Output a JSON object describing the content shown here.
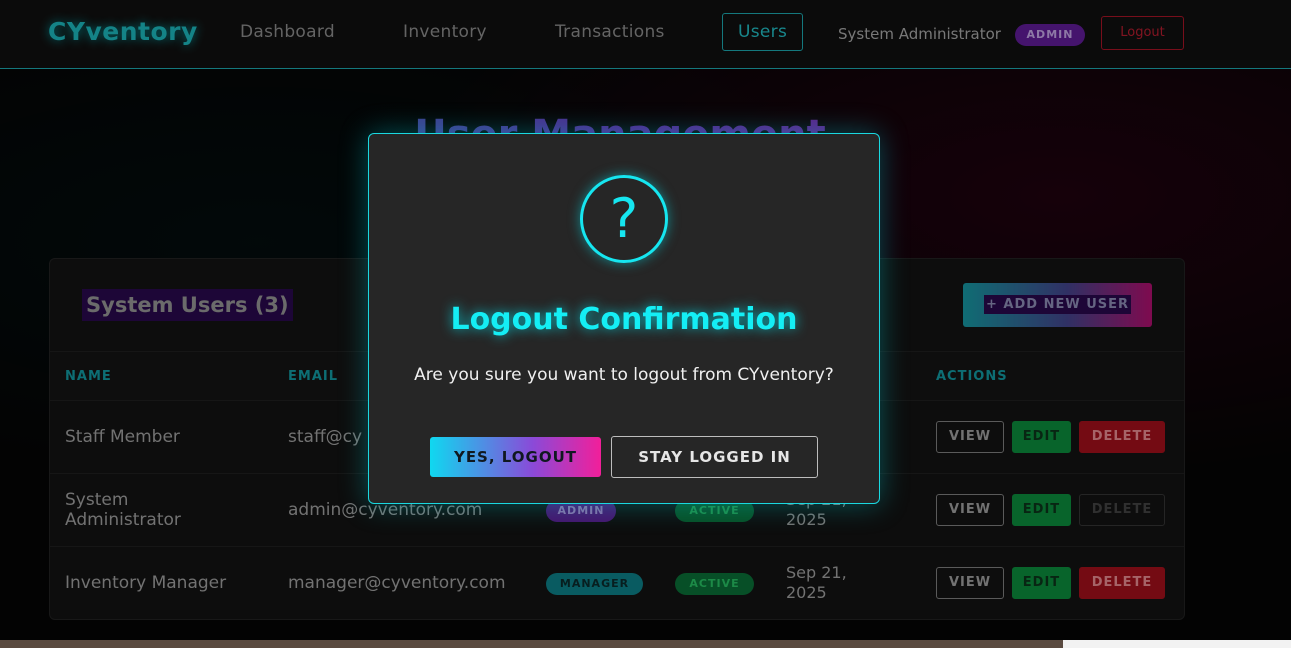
{
  "nav": {
    "brand": "CYventory",
    "links": [
      "Dashboard",
      "Inventory",
      "Transactions",
      "Users"
    ],
    "user_name": "System Administrator",
    "user_role": "ADMIN",
    "logout_label": "Logout"
  },
  "page": {
    "title": "User Management"
  },
  "users_card": {
    "title": "System Users (3)",
    "add_button": "+ ADD NEW USER",
    "columns": [
      "NAME",
      "EMAIL",
      "ACTIONS"
    ],
    "rows": [
      {
        "name": "Staff Member",
        "email": "staff@cy",
        "actions": [
          "VIEW",
          "EDIT",
          "DELETE"
        ]
      },
      {
        "name": "System Administrator",
        "email": "admin@cyventory.com",
        "role": "ADMIN",
        "status": "ACTIVE",
        "date": "Sep 21, 2025",
        "actions": [
          "VIEW",
          "EDIT",
          "DELETE"
        ],
        "delete_disabled": true
      },
      {
        "name": "Inventory Manager",
        "email": "manager@cyventory.com",
        "role": "MANAGER",
        "status": "ACTIVE",
        "date": "Sep 21, 2025",
        "actions": [
          "VIEW",
          "EDIT",
          "DELETE"
        ]
      }
    ]
  },
  "modal": {
    "icon": "question-mark-icon",
    "icon_glyph": "?",
    "title": "Logout Confirmation",
    "message": "Are you sure you want to logout from CYventory?",
    "confirm_label": "YES, LOGOUT",
    "cancel_label": "STAY LOGGED IN"
  },
  "colors": {
    "accent": "#1fc9cf",
    "admin_role": "#6a1fa8",
    "danger": "#b3111e",
    "success": "#0d9a42"
  }
}
